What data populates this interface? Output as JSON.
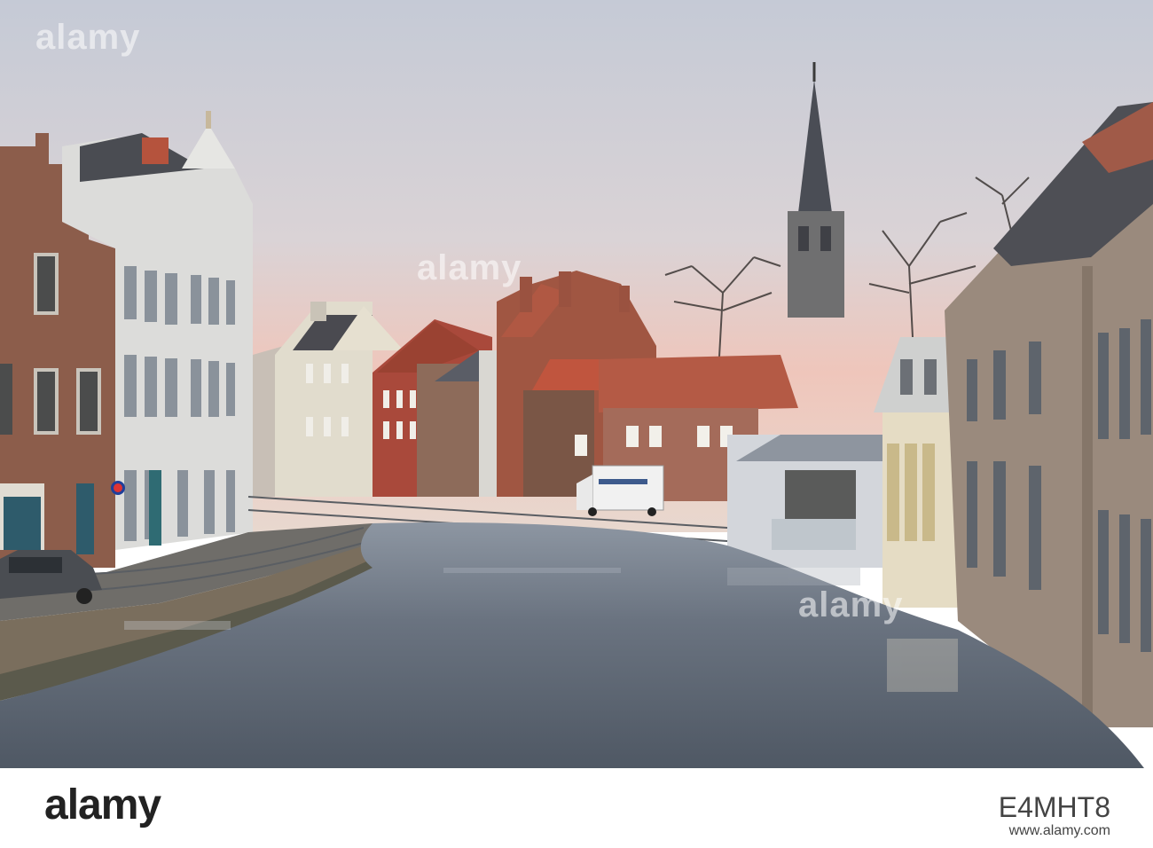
{
  "image": {
    "subject": "canal-townscape",
    "colors": {
      "sky_top": "#c9ccd8",
      "sky_glow": "#f2c3b6",
      "water": "#5d6673",
      "brick": "#8b5a48",
      "white_house": "#d7d8d6"
    }
  },
  "watermark": {
    "text": "alamy"
  },
  "footer": {
    "brand": "alamy",
    "image_code": "E4MHT8",
    "url": "www.alamy.com"
  }
}
